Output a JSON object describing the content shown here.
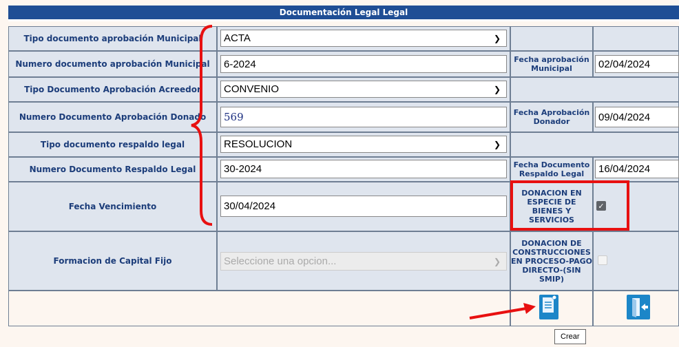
{
  "header": {
    "title": "Documentación Legal Legal"
  },
  "rows": [
    {
      "label": "Tipo documento aprobación Municipal",
      "field": "ACTA"
    },
    {
      "label": "Numero documento aprobación Municipal",
      "field": "6-2024",
      "side_label": "Fecha aprobación Municipal",
      "side_value": "02/04/2024"
    },
    {
      "label": "Tipo Documento Aprobación Acreedor",
      "field": "CONVENIO"
    },
    {
      "label": "Numero Documento Aprobación Donado",
      "field": "569",
      "side_label": "Fecha Aprobación Donador",
      "side_value": "09/04/2024"
    },
    {
      "label": "Tipo documento respaldo legal",
      "field": "RESOLUCION"
    },
    {
      "label": "Numero Documento Respaldo Legal",
      "field": "30-2024",
      "side_label": "Fecha Documento Respaldo Legal",
      "side_value": "16/04/2024"
    },
    {
      "label": "Fecha Vencimiento",
      "field": "30/04/2024",
      "side_label": "DONACION EN ESPECIE DE BIENES Y SERVICIOS",
      "checked": true
    },
    {
      "label": "Formacion de Capital Fijo",
      "placeholder": "Seleccione una opcion...",
      "side_label": "DONACION DE CONSTRUCCIONES EN PROCESO-PAGO DIRECTO-(SIN SMIP)",
      "checked": false
    }
  ],
  "tooltip": "Crear",
  "icons": {
    "create": "document-create-icon",
    "exit": "exit-door-icon"
  },
  "colors": {
    "header": "#1f4e95",
    "label_text": "#1c3d7a",
    "cell_bg": "#dfe5ee",
    "annotation": "#e81010",
    "icon": "#1c86c8"
  }
}
